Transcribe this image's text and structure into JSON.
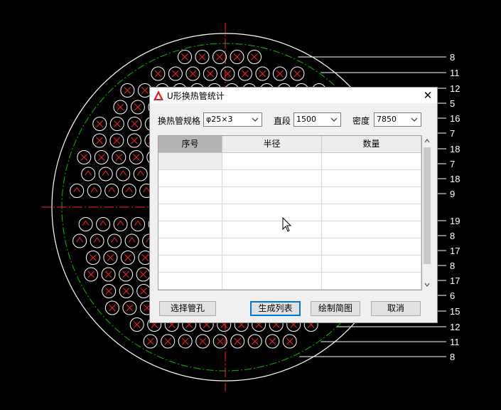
{
  "drawing": {
    "row_labels": [
      {
        "side": "right",
        "text": "8"
      },
      {
        "side": "right",
        "text": "11"
      },
      {
        "side": "right",
        "text": "12"
      },
      {
        "side": "right",
        "text": "5"
      },
      {
        "side": "right",
        "text": "16"
      },
      {
        "side": "right",
        "text": "7"
      },
      {
        "side": "right",
        "text": "18"
      },
      {
        "side": "right",
        "text": "7"
      },
      {
        "side": "right",
        "text": "18"
      },
      {
        "side": "right",
        "text": "9"
      },
      {
        "side": "right",
        "text": "19"
      },
      {
        "side": "right",
        "text": "8"
      },
      {
        "side": "right",
        "text": "17"
      },
      {
        "side": "right",
        "text": "8"
      },
      {
        "side": "right",
        "text": "17"
      },
      {
        "side": "right",
        "text": "6"
      },
      {
        "side": "right",
        "text": "15"
      },
      {
        "side": "right",
        "text": "12"
      },
      {
        "side": "right",
        "text": "11"
      },
      {
        "side": "right",
        "text": "8"
      }
    ],
    "colors": {
      "circle": "#ffffff",
      "mark": "#ff2020",
      "center_line": "#ff2020",
      "dash_ring": "#00c000"
    }
  },
  "dialog": {
    "title": "U形换热管统计",
    "close_glyph": "✕",
    "spec_label": "换热管规格",
    "spec_value": "φ25×3",
    "straight_label": "直段",
    "straight_value": "1500",
    "density_label": "密度",
    "density_value": "7850",
    "table": {
      "columns": [
        "序号",
        "半径",
        "数量"
      ],
      "rows": [
        [
          "",
          "",
          ""
        ],
        [
          "",
          "",
          ""
        ],
        [
          "",
          "",
          ""
        ],
        [
          "",
          "",
          ""
        ],
        [
          "",
          "",
          ""
        ],
        [
          "",
          "",
          ""
        ],
        [
          "",
          "",
          ""
        ],
        [
          "",
          "",
          ""
        ]
      ]
    },
    "buttons": {
      "select": "选择管孔",
      "generate": "生成列表",
      "draw": "绘制简图",
      "cancel": "取消"
    }
  }
}
